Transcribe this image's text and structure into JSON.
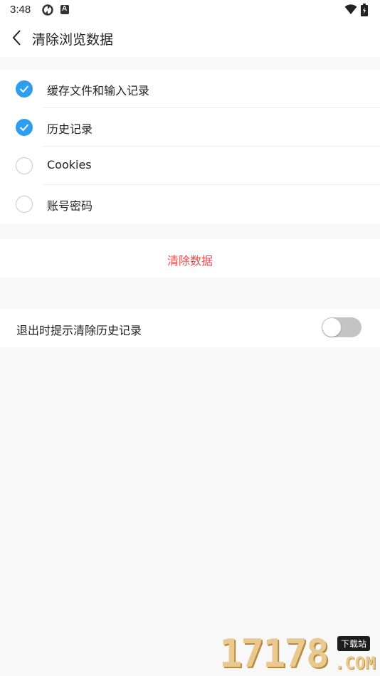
{
  "status_bar": {
    "time": "3:48",
    "icons": [
      "sync-icon",
      "a-icon",
      "wifi-icon",
      "battery-icon"
    ]
  },
  "app_bar": {
    "back_icon": "chevron-left-icon",
    "title": "清除浏览数据"
  },
  "options": [
    {
      "label": "缓存文件和输入记录",
      "checked": true
    },
    {
      "label": "历史记录",
      "checked": true
    },
    {
      "label": "Cookies",
      "checked": false
    },
    {
      "label": "账号密码",
      "checked": false
    }
  ],
  "clear_button": {
    "label": "清除数据",
    "color": "#f04848"
  },
  "toggle": {
    "label": "退出时提示清除历史记录",
    "on": false
  },
  "colors": {
    "accent": "#2d9df0",
    "danger": "#f04848",
    "background": "#f8f8f8"
  },
  "watermark": {
    "digits": "17178",
    "badge": "下载站",
    "suffix": ".COM"
  }
}
